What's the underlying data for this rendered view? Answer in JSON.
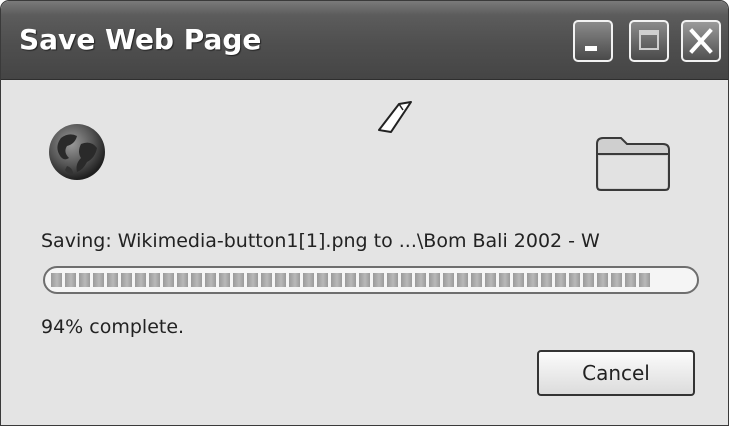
{
  "window": {
    "title": "Save Web Page",
    "controls": [
      "minimize-icon",
      "maximize-icon",
      "close-icon"
    ]
  },
  "status": {
    "saving_text": "Saving: Wikimedia-button1[1].png to ...\\Bom Bali 2002 - W",
    "percent_text": "94% complete.",
    "progress_value": 0.94
  },
  "buttons": {
    "cancel_label": "Cancel"
  },
  "icons": {
    "source": "globe-icon",
    "transfer": "paper-flying-icon",
    "destination": "folder-icon"
  }
}
